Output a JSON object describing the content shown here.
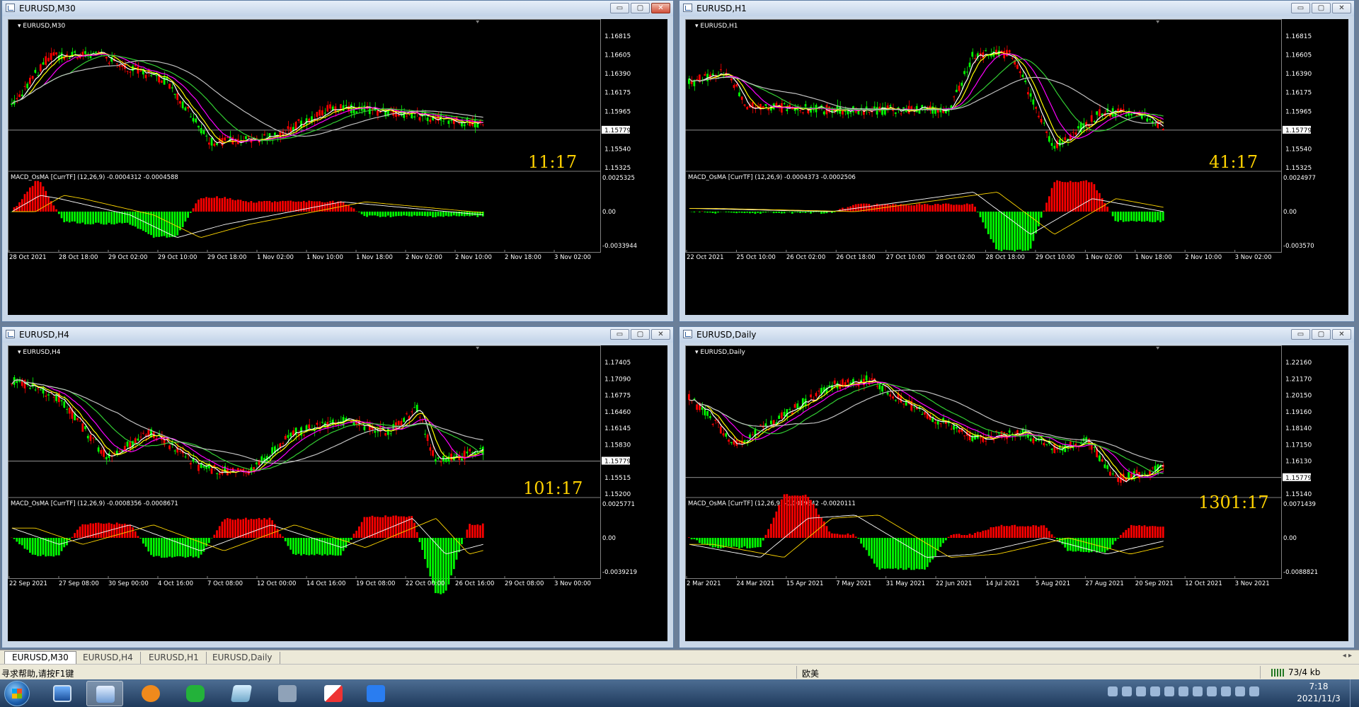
{
  "windows": [
    {
      "id": "m30",
      "title": "EURUSD,M30",
      "chart_label": "EURUSD,M30",
      "price_labels": [
        "1.16815",
        "1.16605",
        "1.16390",
        "1.16175",
        "1.15965",
        "1.15779",
        "1.15540",
        "1.15325"
      ],
      "current_price": "1.15779",
      "indicator_label": "MACD_OsMA [CurrTF] (12,26,9) -0.0004312 -0.0004588",
      "indicator_scale": [
        "0.0025325",
        "0.00",
        "-0.0033944"
      ],
      "time_labels": [
        "28 Oct 2021",
        "28 Oct 18:00",
        "29 Oct 02:00",
        "29 Oct 10:00",
        "29 Oct 18:00",
        "1 Nov 02:00",
        "1 Nov 10:00",
        "1 Nov 18:00",
        "2 Nov 02:00",
        "2 Nov 10:00",
        "2 Nov 18:00",
        "3 Nov 02:00"
      ],
      "countdown": "11:17",
      "close_active": true
    },
    {
      "id": "h1",
      "title": "EURUSD,H1",
      "chart_label": "EURUSD,H1",
      "price_labels": [
        "1.16815",
        "1.16605",
        "1.16390",
        "1.16175",
        "1.15965",
        "1.15779",
        "1.15540",
        "1.15325"
      ],
      "current_price": "1.15779",
      "indicator_label": "MACD_OsMA [CurrTF] (12,26,9) -0.0004373 -0.0002506",
      "indicator_scale": [
        "0.0024977",
        "0.00",
        "-0.003570"
      ],
      "time_labels": [
        "22 Oct 2021",
        "25 Oct 10:00",
        "26 Oct 02:00",
        "26 Oct 18:00",
        "27 Oct 10:00",
        "28 Oct 02:00",
        "28 Oct 18:00",
        "29 Oct 10:00",
        "1 Nov 02:00",
        "1 Nov 18:00",
        "2 Nov 10:00",
        "3 Nov 02:00"
      ],
      "countdown": "41:17",
      "close_active": false
    },
    {
      "id": "h4",
      "title": "EURUSD,H4",
      "chart_label": "EURUSD,H4",
      "price_labels": [
        "1.17405",
        "1.17090",
        "1.16775",
        "1.16460",
        "1.16145",
        "1.15830",
        "1.15779",
        "1.15515",
        "1.15200"
      ],
      "current_price": "1.15779",
      "indicator_label": "MACD_OsMA [CurrTF] (12,26,9) -0.0008356 -0.0008671",
      "indicator_scale": [
        "0.0025771",
        "0.00",
        "-0.0039219"
      ],
      "time_labels": [
        "22 Sep 2021",
        "27 Sep 08:00",
        "30 Sep 00:00",
        "4 Oct 16:00",
        "7 Oct 08:00",
        "12 Oct 00:00",
        "14 Oct 16:00",
        "19 Oct 08:00",
        "22 Oct 00:00",
        "26 Oct 16:00",
        "29 Oct 08:00",
        "3 Nov 00:00"
      ],
      "countdown": "101:17",
      "close_active": false
    },
    {
      "id": "daily",
      "title": "EURUSD,Daily",
      "chart_label": "EURUSD,Daily",
      "price_labels": [
        "1.22160",
        "1.21170",
        "1.20150",
        "1.19160",
        "1.18140",
        "1.17150",
        "1.16130",
        "1.15779",
        "1.15140"
      ],
      "current_price": "1.15779",
      "indicator_label": "MACD_OsMA [CurrTF] (12,26,9) -0.0019842 -0.0020111",
      "indicator_scale": [
        "0.0071439",
        "0.00",
        "-0.0088821"
      ],
      "time_labels": [
        "2 Mar 2021",
        "24 Mar 2021",
        "15 Apr 2021",
        "7 May 2021",
        "31 May 2021",
        "22 Jun 2021",
        "14 Jul 2021",
        "5 Aug 2021",
        "27 Aug 2021",
        "20 Sep 2021",
        "12 Oct 2021",
        "3 Nov 2021"
      ],
      "countdown": "1301:17",
      "close_active": false
    }
  ],
  "window_buttons": {
    "minimize": "▭",
    "maximize": "▢",
    "close": "✕"
  },
  "tabs": [
    "EURUSD,M30",
    "EURUSD,H4",
    "EURUSD,H1",
    "EURUSD,Daily"
  ],
  "tab_arrows": "◂ ▸",
  "status": {
    "help": "寻求帮助,请按F1键",
    "profile": "欧美",
    "connection": "73/4 kb"
  },
  "clock": {
    "time": "7:18",
    "date": "2021/11/3"
  },
  "colors": {
    "bull": "#00ff00",
    "bear": "#ff0000",
    "ma_fast": "#ffffff",
    "ma_yellow": "#ffff00",
    "ma_magenta": "#ff00ff",
    "ma_green": "#32cd32",
    "ma_gray": "#c0c0c0",
    "macd_line": "#ffffff",
    "signal_line": "#ffd700",
    "countdown": "#ffd200"
  }
}
